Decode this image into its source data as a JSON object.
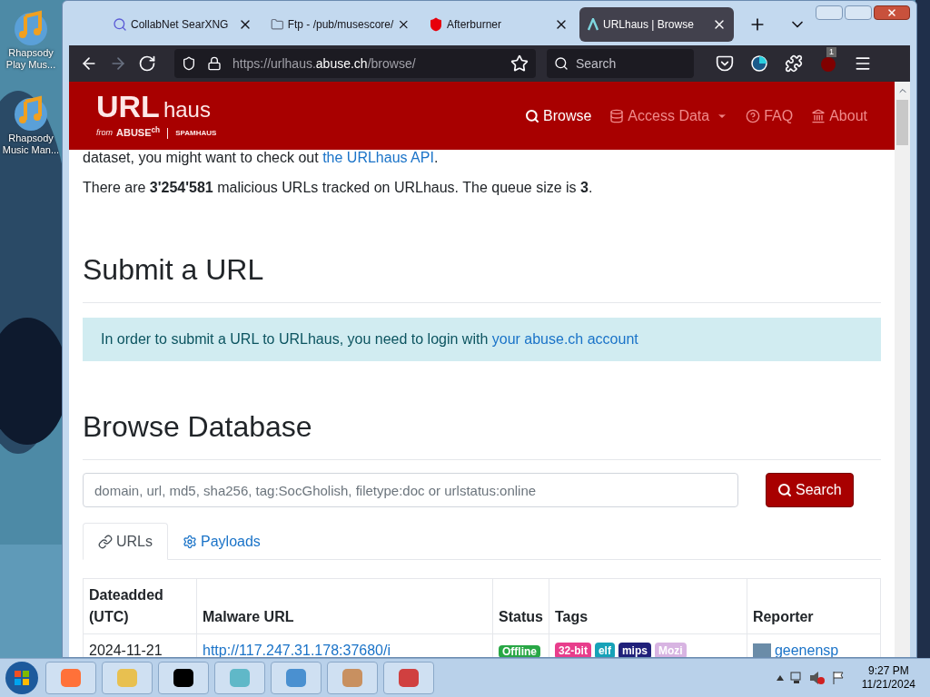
{
  "desktop_icons": [
    {
      "label": "Rhapsody Play Mus..."
    },
    {
      "label": "Rhapsody Music Man..."
    }
  ],
  "tabs": [
    {
      "title": "CollabNet SearXNG",
      "kind": "search",
      "selected": false
    },
    {
      "title": "Ftp - /pub/musescore/",
      "kind": "folder",
      "selected": false
    },
    {
      "title": "Afterburner",
      "kind": "shield",
      "selected": false
    },
    {
      "title": "URLhaus | Browse",
      "kind": "logo",
      "selected": true
    }
  ],
  "address_bar": {
    "prefix": "https://urlhaus.",
    "domain": "abuse.ch",
    "path": "/browse/"
  },
  "toolbar_search": {
    "placeholder": "Search"
  },
  "extension_badge": "1",
  "site": {
    "logo_main": "URL",
    "logo_sub": "haus",
    "logo_from": "from",
    "logo_abuse": "ABUSE",
    "logo_ch": "ch",
    "logo_partner": "SPAMHAUS",
    "nav": [
      {
        "label": "Browse",
        "kind": "search",
        "selected": true
      },
      {
        "label": "Access Data",
        "kind": "database",
        "selected": false
      },
      {
        "label": "FAQ",
        "kind": "help",
        "selected": false
      },
      {
        "label": "About",
        "kind": "home",
        "selected": false
      }
    ]
  },
  "intro_cut": {
    "text": "dataset, you might want to check out ",
    "link": "the URLhaus API",
    "end": "."
  },
  "stats": "There are **3'254'581** malicious URLs tracked on URLhaus. The queue size is **3**.",
  "submit": {
    "heading": "Submit a URL",
    "notice": "In order to submit a URL to URLhaus, you need to login with ",
    "link": "your abuse.ch account"
  },
  "browse": {
    "heading": "Browse Database",
    "search_placeholder": "domain, url, md5, sha256, tag:SocGholish, filetype:doc or urlstatus:online",
    "search_button": "Search",
    "tabs": [
      {
        "label": "URLs",
        "kind": "link",
        "selected": true
      },
      {
        "label": "Payloads",
        "kind": "gear",
        "selected": false
      }
    ]
  },
  "table": {
    "columns": [
      "Dateadded (UTC)",
      "Malware URL",
      "Status",
      "Tags",
      "Reporter"
    ],
    "rows": [
      {
        "date": "2024-11-21",
        "url": "http://117.247.31.178:37680/i",
        "status": "Offline",
        "tags": [
          {
            "label": "32-bit",
            "color": "#e83e8c"
          },
          {
            "label": "elf",
            "color": "#17a2b8"
          },
          {
            "label": "mips",
            "color": "#20207a"
          },
          {
            "label": "Mozi",
            "color": "#d8b4e2"
          }
        ],
        "reporter": "geenensp"
      }
    ]
  },
  "clock": {
    "time": "9:27 PM",
    "date": "11/21/2024"
  }
}
